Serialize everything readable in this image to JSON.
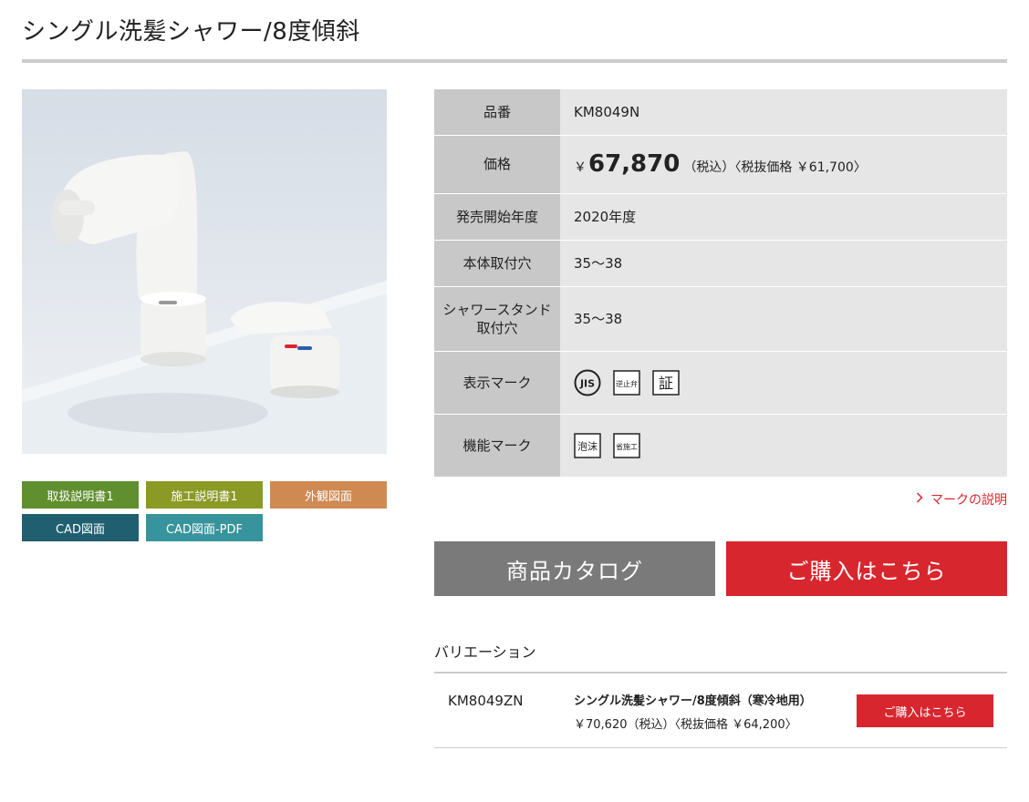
{
  "product": {
    "title": "シングル洗髪シャワー/8度傾斜"
  },
  "doc_buttons": [
    {
      "label": "取扱説明書1",
      "color": "#5f8f2e"
    },
    {
      "label": "施工説明書1",
      "color": "#8a9a25"
    },
    {
      "label": "外観図面",
      "color": "#cf8a52"
    },
    {
      "label": "CAD図面",
      "color": "#1f5f70"
    },
    {
      "label": "CAD図面-PDF",
      "color": "#37949c"
    }
  ],
  "specs": {
    "part_no": {
      "label": "品番",
      "value": "KM8049N"
    },
    "price": {
      "label": "価格",
      "yen": "￥",
      "amount": "67,870",
      "note": "（税込）〈税抜価格 ￥61,700〉"
    },
    "release": {
      "label": "発売開始年度",
      "value": "2020年度"
    },
    "body_hole": {
      "label": "本体取付穴",
      "value": "35〜38"
    },
    "shower_hole": {
      "label": "シャワースタンド取付穴",
      "value": "35〜38"
    },
    "display_marks": {
      "label": "表示マーク",
      "marks": [
        {
          "icon": "jis-mark-icon",
          "text": "JIS"
        },
        {
          "icon": "check-valve-mark-icon",
          "text": "逆止弁"
        },
        {
          "icon": "certification-mark-icon",
          "text": "証"
        }
      ]
    },
    "function_marks": {
      "label": "機能マーク",
      "marks": [
        {
          "icon": "foam-mark-icon",
          "text": "泡沫"
        },
        {
          "icon": "easy-install-mark-icon",
          "text": "省施工"
        }
      ]
    }
  },
  "mark_link": "マークの説明",
  "buttons": {
    "catalog": "商品カタログ",
    "purchase": "ご購入はこちら"
  },
  "variation": {
    "heading": "バリエーション",
    "items": [
      {
        "code": "KM8049ZN",
        "name": "シングル洗髪シャワー/8度傾斜（寒冷地用）",
        "price": "￥70,620（税込）〈税抜価格 ￥64,200〉",
        "button": "ご購入はこちら"
      }
    ]
  },
  "colors": {
    "accent_red": "#d8262f",
    "catalog_gray": "#7a7a7a",
    "label_gray": "#c8c8c8",
    "value_gray": "#e6e6e6"
  }
}
